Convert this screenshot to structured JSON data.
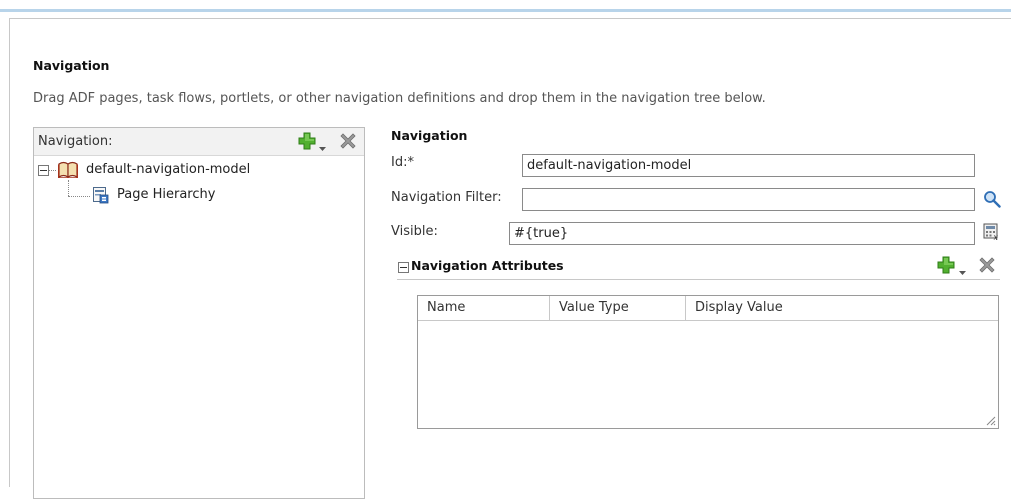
{
  "section": {
    "title": "Navigation",
    "description": "Drag ADF pages, task flows, portlets, or other navigation definitions and drop them in the navigation tree below."
  },
  "nav_panel": {
    "label": "Navigation:",
    "tree": [
      {
        "label": "default-navigation-model",
        "icon": "book-icon",
        "expanded": true
      },
      {
        "label": "Page Hierarchy",
        "icon": "page-hierarchy-icon"
      }
    ]
  },
  "properties": {
    "title": "Navigation",
    "id_label": "Id:*",
    "id_value": "default-navigation-model",
    "filter_label": "Navigation Filter:",
    "filter_value": "",
    "visible_label": "Visible:",
    "visible_value": "#{true}"
  },
  "attributes": {
    "title": "Navigation Attributes",
    "columns": [
      "Name",
      "Value Type",
      "Display Value"
    ],
    "rows": []
  },
  "colors": {
    "accent_line": "#b8d4ea",
    "add_green": "#4caf2a",
    "delete_gray": "#8c8c8c"
  }
}
